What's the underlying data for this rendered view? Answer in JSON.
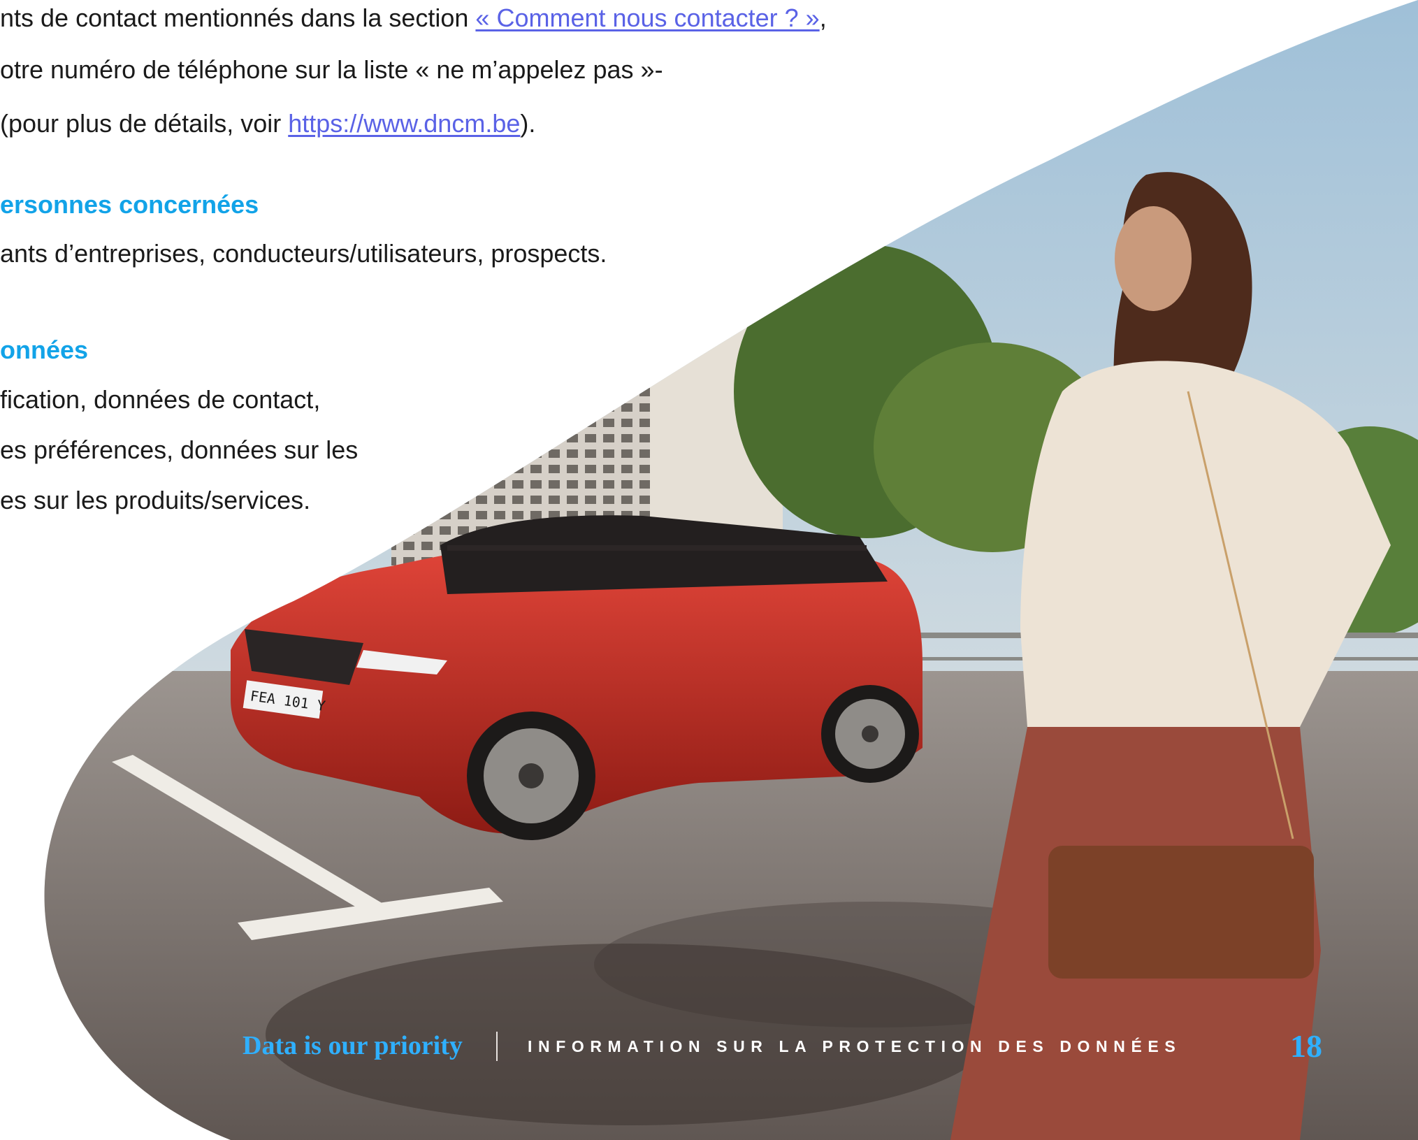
{
  "body_text": {
    "line1_prefix": "nts de contact mentionnés dans la section ",
    "line1_link": "« Comment nous contacter ? »",
    "line1_suffix": ",",
    "line2": "otre numéro de téléphone sur la liste « ne m’appelez pas »-",
    "line3_prefix": "(pour plus de détails, voir ",
    "line3_link": "https://www.dncm.be",
    "line3_suffix": ").",
    "heading1": "ersonnes concernées",
    "line4": "ants d’entreprises, conducteurs/utilisateurs, prospects.",
    "heading2": "onnées",
    "line5": "fication, données de contact,",
    "line6": "es préférences, données sur les",
    "line7": "es sur les produits/services."
  },
  "photo": {
    "description_icon": "photo-woman-and-red-suv",
    "license_plate": "FEA 101 Y"
  },
  "footer": {
    "brand": "Data is our priority",
    "title": "INFORMATION SUR LA PROTECTION DES DONNÉES",
    "page_number": "18"
  },
  "colors": {
    "link": "#5a62e6",
    "heading": "#12a3e8",
    "brand": "#2fb0ff",
    "car": "#c8281e"
  }
}
